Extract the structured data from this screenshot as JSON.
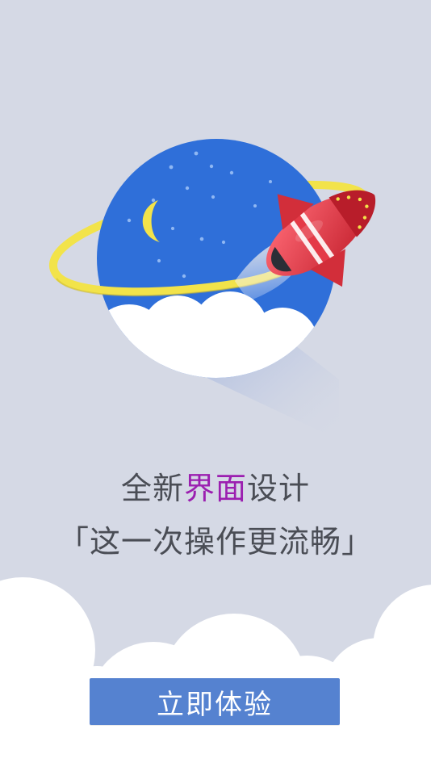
{
  "headline": {
    "line1_prefix": "全新",
    "line1_accent": "界面",
    "line1_suffix": "设计",
    "line2": "「这一次操作更流畅」"
  },
  "cta": {
    "label": "立即体验"
  },
  "colors": {
    "background": "#d5d9e5",
    "planet": "#2f6fd9",
    "ring": "#f2e34a",
    "rocket": "#e43a47",
    "accent_text": "#9b1fb0",
    "button": "#5582d0"
  },
  "icons": {
    "hero": "rocket-planet-illustration",
    "moon": "moon-icon"
  }
}
